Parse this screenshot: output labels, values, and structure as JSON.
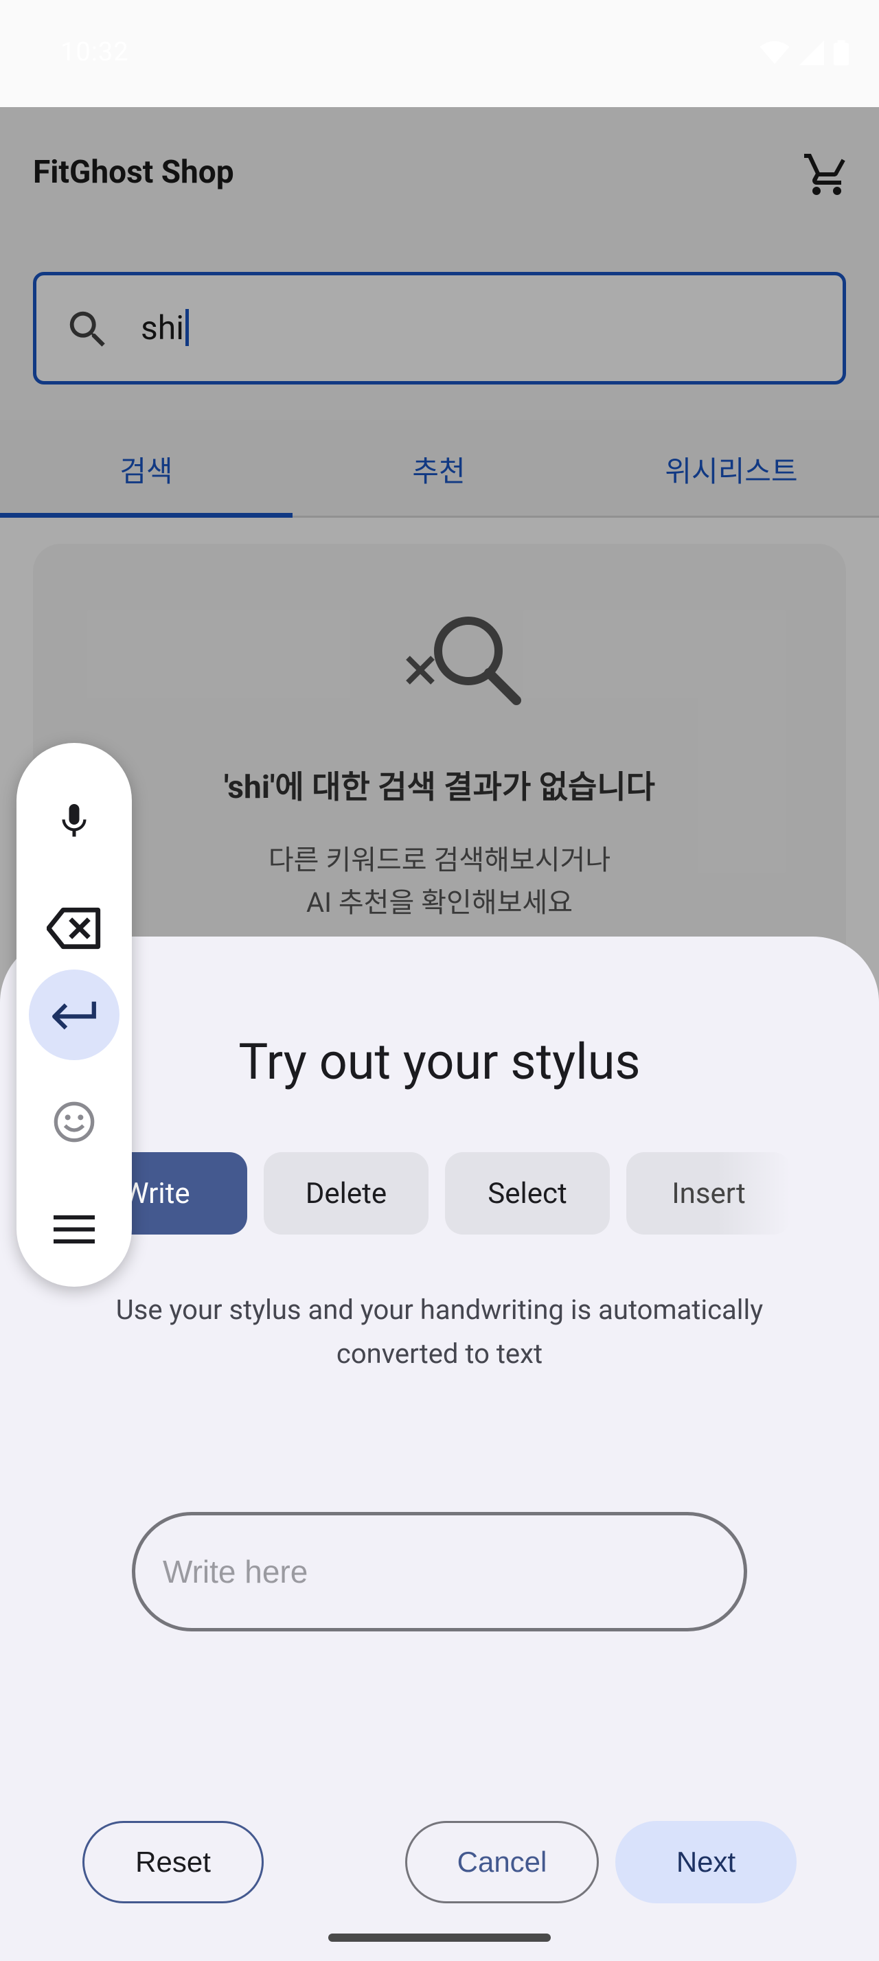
{
  "status_bar": {
    "time": "10:32"
  },
  "app": {
    "title": "FitGhost Shop",
    "search": {
      "value": "shi"
    },
    "tabs": [
      {
        "label": "검색",
        "selected": true
      },
      {
        "label": "추천",
        "selected": false
      },
      {
        "label": "위시리스트",
        "selected": false
      }
    ],
    "empty_state": {
      "title": "'shi'에 대한 검색 결과가 없습니다",
      "line1": "다른 키워드로 검색해보시거나",
      "line2": "AI 추천을 확인해보세요"
    }
  },
  "stylus_sheet": {
    "title": "Try out your stylus",
    "chips": [
      {
        "label": "Write",
        "selected": true
      },
      {
        "label": "Delete",
        "selected": false
      },
      {
        "label": "Select",
        "selected": false
      },
      {
        "label": "Insert",
        "selected": false
      }
    ],
    "description_line1": "Use your stylus and your handwriting is automatically",
    "description_line2": "converted to text",
    "write_placeholder": "Write here",
    "buttons": {
      "reset": "Reset",
      "cancel": "Cancel",
      "next": "Next"
    }
  },
  "toolbar": {
    "items": [
      "microphone-icon",
      "backspace-icon",
      "enter-icon",
      "emoji-icon",
      "menu-icon"
    ],
    "active": "enter-icon"
  },
  "colors": {
    "accent": "#1a56c4",
    "chip_active": "#44598f",
    "next_button": "#d9e2fb"
  }
}
